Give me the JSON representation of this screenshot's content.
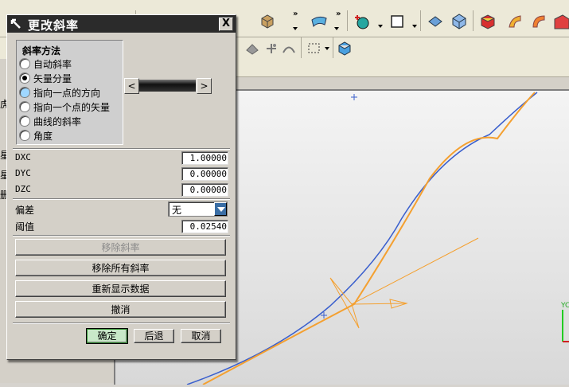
{
  "dialog": {
    "title": "更改斜率",
    "close_glyph": "X",
    "method_group": {
      "title": "斜率方法",
      "options": [
        {
          "label": "自动斜率",
          "selected": false
        },
        {
          "label": "矢量分量",
          "selected": true
        },
        {
          "label": "指向一点的方向",
          "selected": false
        },
        {
          "label": "指向一个点的矢量",
          "selected": false
        },
        {
          "label": "曲线的斜率",
          "selected": false
        },
        {
          "label": "角度",
          "selected": false
        }
      ]
    },
    "slider": {
      "left_glyph": "<",
      "right_glyph": ">"
    },
    "fields": {
      "dxc": {
        "label": "DXC",
        "value": "1.00000"
      },
      "dyc": {
        "label": "DYC",
        "value": "0.00000"
      },
      "dzc": {
        "label": "DZC",
        "value": "0.00000"
      },
      "deviation": {
        "label": "偏差",
        "value": "无"
      },
      "threshold": {
        "label": "阈值",
        "value": "0.02540"
      }
    },
    "buttons": {
      "remove_slope": "移除斜率",
      "remove_all_slopes": "移除所有斜率",
      "redisplay_data": "重新显示数据",
      "undo": "撤消",
      "ok": "确定",
      "back": "后退",
      "cancel": "取消"
    }
  },
  "left_panel_fragments": [
    "虎",
    "星",
    "星",
    "删"
  ],
  "axis_label": "YC",
  "colors": {
    "curve_blue": "#3a5fcd",
    "curve_orange": "#f4a030",
    "titlebar": "#2b2b2b",
    "ok_border": "#2f8f2f",
    "axis_green": "#22cc22"
  }
}
